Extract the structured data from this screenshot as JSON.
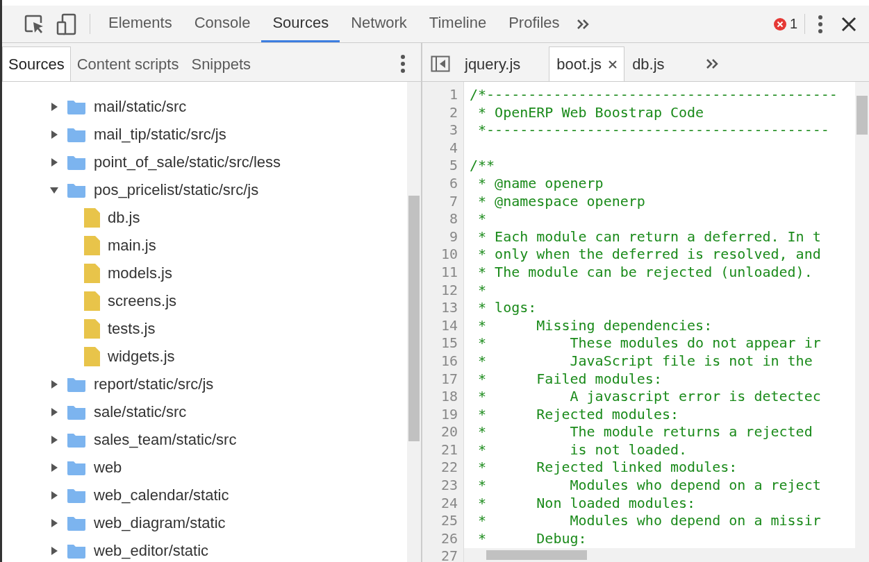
{
  "toolbar": {
    "tabs": [
      {
        "label": "Elements",
        "selected": false
      },
      {
        "label": "Console",
        "selected": false
      },
      {
        "label": "Sources",
        "selected": true
      },
      {
        "label": "Network",
        "selected": false
      },
      {
        "label": "Timeline",
        "selected": false
      },
      {
        "label": "Profiles",
        "selected": false
      }
    ],
    "error_count": "1"
  },
  "navigator": {
    "tabs": [
      {
        "label": "Sources",
        "selected": true
      },
      {
        "label": "Content scripts",
        "selected": false
      },
      {
        "label": "Snippets",
        "selected": false
      }
    ],
    "tree": [
      {
        "kind": "folder",
        "label": "mail/static/src",
        "expanded": false
      },
      {
        "kind": "folder",
        "label": "mail_tip/static/src/js",
        "expanded": false
      },
      {
        "kind": "folder",
        "label": "point_of_sale/static/src/less",
        "expanded": false
      },
      {
        "kind": "folder",
        "label": "pos_pricelist/static/src/js",
        "expanded": true,
        "children": [
          {
            "kind": "file",
            "label": "db.js"
          },
          {
            "kind": "file",
            "label": "main.js"
          },
          {
            "kind": "file",
            "label": "models.js"
          },
          {
            "kind": "file",
            "label": "screens.js"
          },
          {
            "kind": "file",
            "label": "tests.js"
          },
          {
            "kind": "file",
            "label": "widgets.js"
          }
        ]
      },
      {
        "kind": "folder",
        "label": "report/static/src/js",
        "expanded": false
      },
      {
        "kind": "folder",
        "label": "sale/static/src",
        "expanded": false
      },
      {
        "kind": "folder",
        "label": "sales_team/static/src",
        "expanded": false
      },
      {
        "kind": "folder",
        "label": "web",
        "expanded": false
      },
      {
        "kind": "folder",
        "label": "web_calendar/static",
        "expanded": false
      },
      {
        "kind": "folder",
        "label": "web_diagram/static",
        "expanded": false
      },
      {
        "kind": "folder",
        "label": "web_editor/static",
        "expanded": false
      }
    ]
  },
  "editor": {
    "tabs": [
      {
        "label": "jquery.js",
        "selected": false
      },
      {
        "label": "boot.js",
        "selected": true
      },
      {
        "label": "db.js",
        "selected": false
      }
    ],
    "lines": [
      {
        "number": "1",
        "text": "/*------------------------------------------"
      },
      {
        "number": "2",
        "text": " * OpenERP Web Boostrap Code"
      },
      {
        "number": "3",
        "text": " *-----------------------------------------"
      },
      {
        "number": "4"
      },
      {
        "number": "5",
        "text": "/**"
      },
      {
        "number": "6",
        "text": " * @name openerp"
      },
      {
        "number": "7",
        "text": " * @namespace openerp"
      },
      {
        "number": "8",
        "text": " *"
      },
      {
        "number": "9",
        "text": " * Each module can return a deferred. In t"
      },
      {
        "number": "10",
        "text": " * only when the deferred is resolved, and"
      },
      {
        "number": "11",
        "text": " * The module can be rejected (unloaded)."
      },
      {
        "number": "12",
        "text": " *"
      },
      {
        "number": "13",
        "text": " * logs:"
      },
      {
        "number": "14",
        "text": " *      Missing dependencies:"
      },
      {
        "number": "15",
        "text": " *          These modules do not appear ir"
      },
      {
        "number": "16",
        "text": " *          JavaScript file is not in the"
      },
      {
        "number": "17",
        "text": " *      Failed modules:"
      },
      {
        "number": "18",
        "text": " *          A javascript error is detectec"
      },
      {
        "number": "19",
        "text": " *      Rejected modules:"
      },
      {
        "number": "20",
        "text": " *          The module returns a rejected"
      },
      {
        "number": "21",
        "text": " *          is not loaded."
      },
      {
        "number": "22",
        "text": " *      Rejected linked modules:"
      },
      {
        "number": "23",
        "text": " *          Modules who depend on a reject"
      },
      {
        "number": "24",
        "text": " *      Non loaded modules:"
      },
      {
        "number": "25",
        "text": " *          Modules who depend on a missir"
      },
      {
        "number": "26",
        "text": " *      Debug:"
      },
      {
        "number": "27"
      }
    ]
  }
}
